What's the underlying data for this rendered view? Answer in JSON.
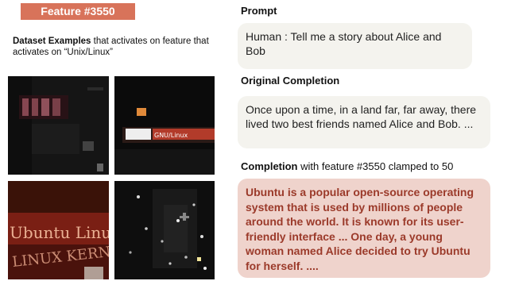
{
  "badge": {
    "label": "Feature #3550"
  },
  "dataset": {
    "caption_bold": "Dataset Examples",
    "caption_rest": " that activates on feature that activates on “Unix/Linux”"
  },
  "thumbnails": [
    {
      "label": "Ubuntu screen closeup",
      "overlay_text": ""
    },
    {
      "label": "GNU/Linux terminal",
      "overlay_text": "GNU/Linux"
    },
    {
      "label": "Ubuntu Linux book cover",
      "overlay_text_1": "Ubuntu Linux",
      "overlay_text_2": "LINUX KERNE"
    },
    {
      "label": "dark scene with lights",
      "overlay_text": ""
    }
  ],
  "prompt": {
    "label": "Prompt",
    "text": "Human : Tell me a story about Alice and Bob"
  },
  "original": {
    "label": "Original Completion",
    "text": "Once upon a time, in a land far, far away, there lived two best friends named Alice and Bob. ..."
  },
  "clamped": {
    "label_bold": "Completion",
    "label_rest": " with feature #3550 clamped to 50",
    "text": "Ubuntu is a popular open-source operating system that is used by millions of people around the world. It is known for its user-friendly interface ... One day, a young woman named Alice decided to try Ubuntu for herself. ...."
  },
  "colors": {
    "badge_bg": "#d8735a",
    "bubble_neutral": "#f4f3ee",
    "bubble_clamped": "#efd3cc",
    "clamped_text": "#9b3a2a"
  }
}
